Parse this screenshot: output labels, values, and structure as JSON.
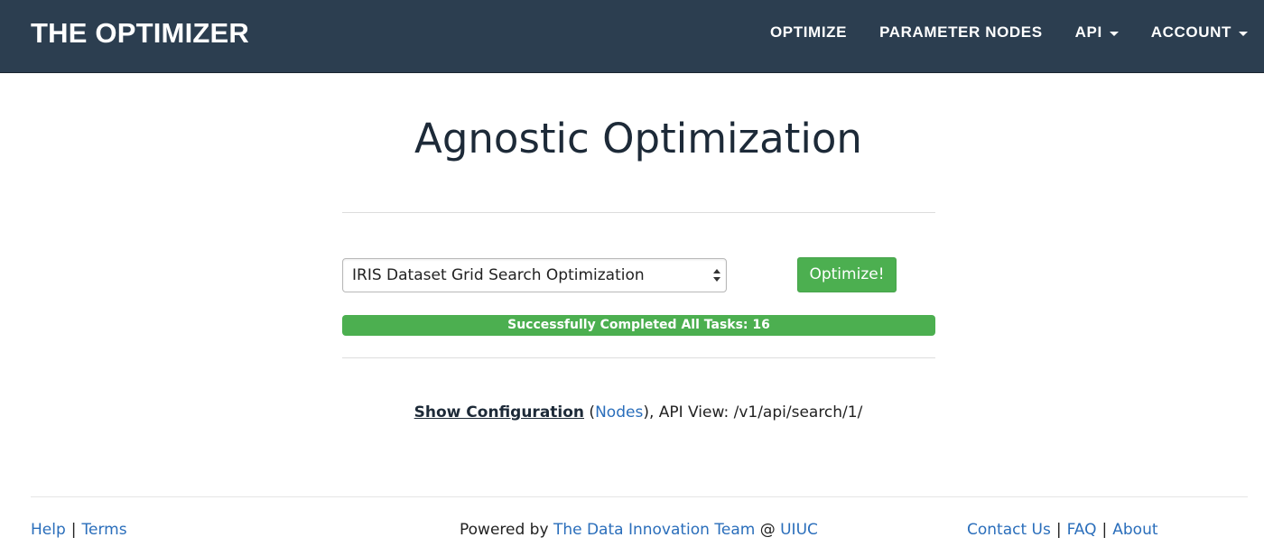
{
  "navbar": {
    "brand": "THE OPTIMIZER",
    "items": [
      {
        "label": "OPTIMIZE",
        "dropdown": false
      },
      {
        "label": "PARAMETER NODES",
        "dropdown": false
      },
      {
        "label": "API",
        "dropdown": true
      },
      {
        "label": "ACCOUNT",
        "dropdown": true
      }
    ]
  },
  "main": {
    "title": "Agnostic Optimization",
    "select": {
      "value": "IRIS Dataset Grid Search Optimization"
    },
    "optimize_button": "Optimize!",
    "progress": {
      "label": "Successfully Completed All Tasks: 16",
      "fraction": 1.0
    },
    "config": {
      "show_configuration": "Show Configuration",
      "open_paren": " (",
      "nodes_link": "Nodes",
      "api_view_text": "), API View: /v1/api/search/1/"
    }
  },
  "footer": {
    "left": {
      "help": "Help",
      "terms": "Terms"
    },
    "center": {
      "powered_by": "Powered by ",
      "team": "The Data Innovation Team",
      "at": " @ ",
      "org": "UIUC"
    },
    "right": {
      "contact": "Contact Us",
      "faq": "FAQ",
      "about": "About"
    },
    "separator": "|"
  },
  "colors": {
    "navbar_bg": "#2c3e50",
    "success_green": "#4caf50",
    "link_blue": "#2a6ebb"
  }
}
